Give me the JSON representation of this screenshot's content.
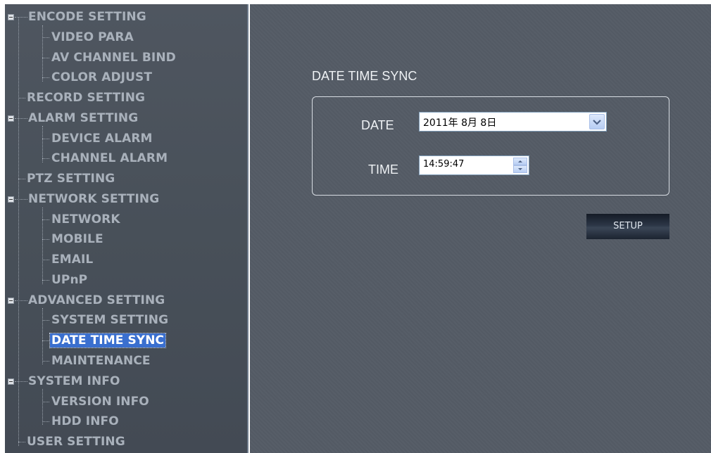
{
  "sidebar": {
    "items": [
      {
        "label": "ENCODE SETTING"
      },
      {
        "label": "VIDEO PARA"
      },
      {
        "label": "AV CHANNEL BIND"
      },
      {
        "label": "COLOR ADJUST"
      },
      {
        "label": "RECORD SETTING"
      },
      {
        "label": "ALARM SETTING"
      },
      {
        "label": "DEVICE ALARM"
      },
      {
        "label": "CHANNEL ALARM"
      },
      {
        "label": "PTZ SETTING"
      },
      {
        "label": "NETWORK SETTING"
      },
      {
        "label": "NETWORK"
      },
      {
        "label": "MOBILE"
      },
      {
        "label": "EMAIL"
      },
      {
        "label": "UPnP"
      },
      {
        "label": "ADVANCED SETTING"
      },
      {
        "label": "SYSTEM SETTING"
      },
      {
        "label": "DATE TIME SYNC"
      },
      {
        "label": "MAINTENANCE"
      },
      {
        "label": "SYSTEM INFO"
      },
      {
        "label": "VERSION INFO"
      },
      {
        "label": "HDD INFO"
      },
      {
        "label": "USER SETTING"
      }
    ],
    "selected": "DATE TIME SYNC"
  },
  "main": {
    "title": "DATE TIME SYNC",
    "date_label": "DATE",
    "date_value": "2011年 8月 8日",
    "time_label": "TIME",
    "time_value": "14:59:47",
    "setup_label": "SETUP"
  },
  "colors": {
    "sidebar_bg": "#4b525c",
    "main_bg": "#555c66",
    "text": "#a9b1bb",
    "selected_bg": "#3a6fcf"
  }
}
